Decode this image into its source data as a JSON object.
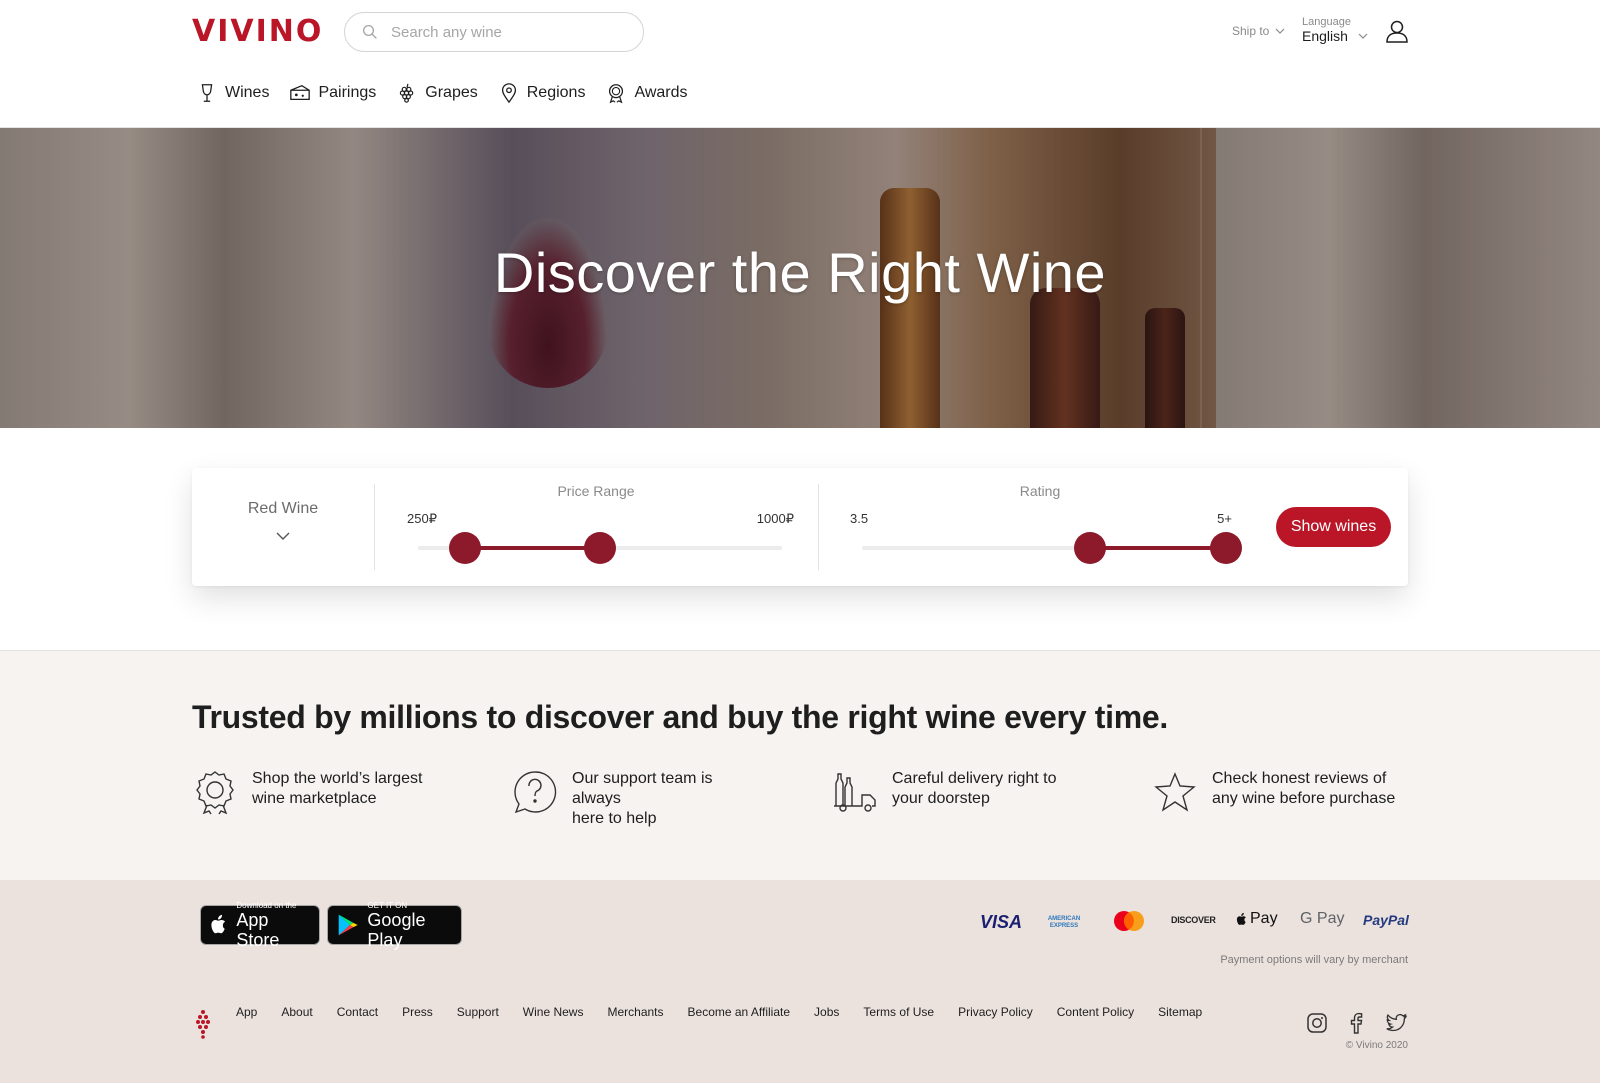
{
  "brand": {
    "logo": "VIVINO",
    "accent": "#ba1628",
    "slider_color": "#8d1a2b"
  },
  "header": {
    "search_placeholder": "Search any wine",
    "ship_to_label": "Ship to",
    "language_label": "Language",
    "language_value": "English"
  },
  "nav": [
    {
      "label": "Wines",
      "icon": "wine-glass-icon"
    },
    {
      "label": "Pairings",
      "icon": "cheese-icon"
    },
    {
      "label": "Grapes",
      "icon": "grapes-icon"
    },
    {
      "label": "Regions",
      "icon": "location-pin-icon"
    },
    {
      "label": "Awards",
      "icon": "award-icon"
    }
  ],
  "hero": {
    "title": "Discover the Right Wine"
  },
  "filter": {
    "wine_type": "Red Wine",
    "price": {
      "title": "Price Range",
      "min_label": "250₽",
      "max_label": "1000₽",
      "low_fraction": 0.13,
      "high_fraction": 0.5
    },
    "rating": {
      "title": "Rating",
      "min_label": "3.5",
      "max_label": "5+",
      "low_fraction": 0.625,
      "high_fraction": 1.0
    },
    "show_button": "Show wines"
  },
  "trust": {
    "heading": "Trusted by millions to discover and buy the right wine every time.",
    "features": [
      {
        "line1": "Shop the world’s largest",
        "line2": "wine marketplace",
        "icon": "award-ribbon-icon"
      },
      {
        "line1": "Our support team is always",
        "line2": "here to help",
        "icon": "question-bubble-icon"
      },
      {
        "line1": "Careful delivery right to",
        "line2": "your doorstep",
        "icon": "delivery-truck-icon"
      },
      {
        "line1": "Check honest reviews of",
        "line2": "any wine before purchase",
        "icon": "star-icon"
      }
    ]
  },
  "footer": {
    "app_store": {
      "small": "Download on the",
      "big": "App Store"
    },
    "google_play": {
      "small": "GET IT ON",
      "big": "Google Play"
    },
    "payments": [
      "VISA",
      "AMERICAN EXPRESS",
      "mastercard",
      "DISCOVER",
      "Pay",
      "G Pay",
      "PayPal"
    ],
    "payment_note": "Payment options will vary by merchant",
    "links": [
      "App",
      "About",
      "Contact",
      "Press",
      "Support",
      "Wine News",
      "Merchants",
      "Become an Affiliate",
      "Jobs",
      "Terms of Use",
      "Privacy Policy",
      "Content Policy",
      "Sitemap"
    ],
    "social": [
      "instagram-icon",
      "facebook-icon",
      "twitter-icon"
    ],
    "copyright": "© Vivino 2020"
  }
}
